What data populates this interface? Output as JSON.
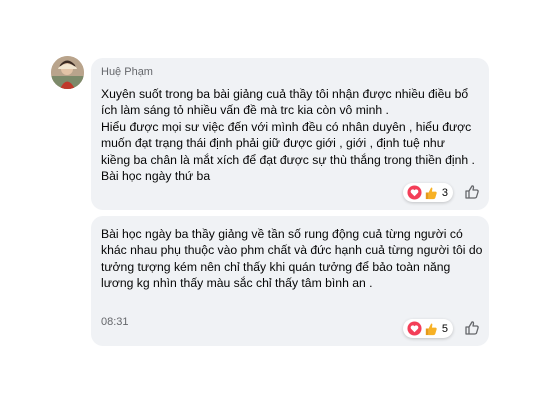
{
  "comments": [
    {
      "author": "Huệ Phạm",
      "lines": [
        "Xuyên suốt trong ba bài giảng cuả thầy tôi nhận được nhiều điều bổ",
        "ích làm sáng tỏ nhiều vấn đề mà trc kia còn vô minh .",
        "Hiểu được mọi sư việc đến với mình đều có nhân duyên , hiểu được",
        "muốn đạt trạng thái định phải giữ được giới , giới , định   tuệ như",
        "kiềng ba chân là mắt xích  để đạt được sự thù thắng trong thiền định .",
        "Bài học ngày thứ ba"
      ],
      "reaction_icons": [
        "heart-icon",
        "care-icon"
      ],
      "reaction_count": "3"
    },
    {
      "lines": [
        "Bài học ngày ba thầy giảng về tần số rung động cuả từng người có",
        "khác nhau phụ thuộc vào phm chất và đức hạnh cuả từng người tôi do",
        "tưởng tượng kém nên chỉ thấy khi quán tưởng để bảo toàn năng",
        "lương kg nhìn thấy màu sắc chỉ thấy tâm bình an ."
      ],
      "time": "08:31",
      "reaction_icons": [
        "heart-icon",
        "care-icon"
      ],
      "reaction_count": "5"
    }
  ],
  "colors": {
    "bubble": "#f0f2f5",
    "text": "#050505",
    "meta": "#65676b",
    "heart": "#f33e58",
    "care": "#f7b125"
  }
}
